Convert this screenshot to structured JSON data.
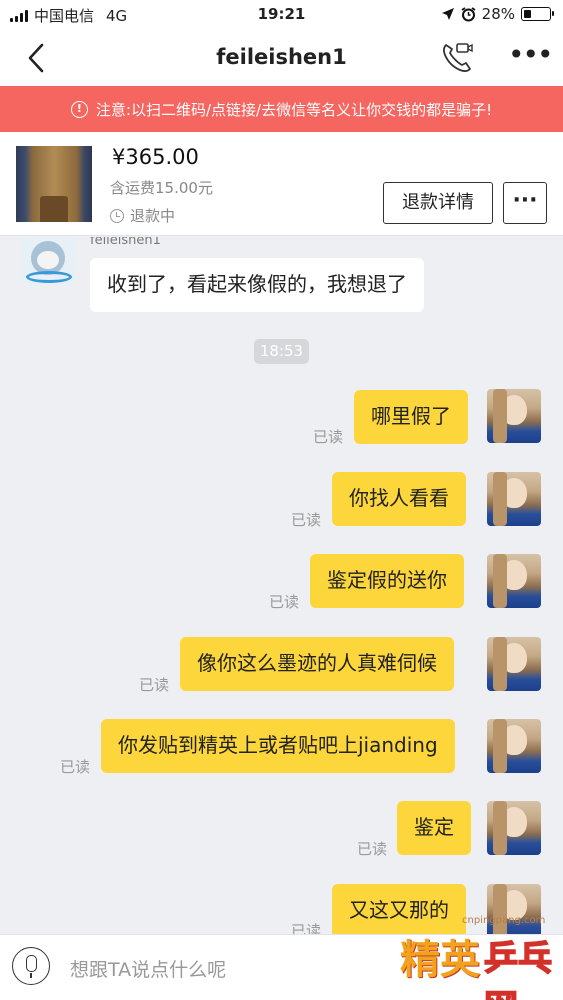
{
  "status_bar": {
    "carrier": "中国电信",
    "network": "4G",
    "time": "19:21",
    "battery": "28%",
    "battery_level": 0.28
  },
  "nav": {
    "title": "feileishen1"
  },
  "warning": {
    "text": "注意:以扫二维码/点链接/去微信等名义让你交钱的都是骗子!"
  },
  "product": {
    "price": "¥365.00",
    "shipping": "含运费15.00元",
    "status": "退款中",
    "refund_button": "退款详情"
  },
  "chat": {
    "sender_name": "feileishen1",
    "incoming": [
      {
        "text": "收到了，看起来像假的，我想退了"
      }
    ],
    "timestamp": "18:53",
    "outgoing": [
      {
        "text": "哪里假了",
        "read": "已读"
      },
      {
        "text": "你找人看看",
        "read": "已读"
      },
      {
        "text": "鉴定假的送你",
        "read": "已读"
      },
      {
        "text": "像你这么墨迹的人真难伺候",
        "read": "已读"
      },
      {
        "text": "你发贴到精英上或者贴吧上jianding",
        "read": "已读"
      },
      {
        "text": "鉴定",
        "read": "已读"
      },
      {
        "text": "又这又那的",
        "read": "已读"
      }
    ]
  },
  "input": {
    "placeholder": "想跟TA说点什么呢"
  },
  "watermark": {
    "url": "cnpingpang.com",
    "logo_left": "精英",
    "logo_right": "乒乓网"
  }
}
